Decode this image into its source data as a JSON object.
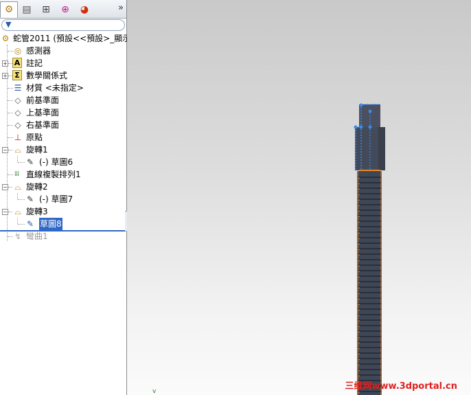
{
  "tabs": {
    "items": [
      {
        "name": "featuremanager-tab",
        "glyph": "🔧"
      },
      {
        "name": "propertymanager-tab",
        "glyph": "📋"
      },
      {
        "name": "configurationmanager-tab",
        "glyph": "🗂"
      },
      {
        "name": "dimxpert-tab",
        "glyph": "⊕"
      },
      {
        "name": "display-manager-tab",
        "glyph": "◑"
      }
    ],
    "more": "»"
  },
  "tree": {
    "root": "蛇管2011 (預設<<預設>_顯示",
    "items": [
      {
        "label": "感測器"
      },
      {
        "label": "註記"
      },
      {
        "label": "數學關係式"
      },
      {
        "label": "材質 <未指定>"
      },
      {
        "label": "前基準面"
      },
      {
        "label": "上基準面"
      },
      {
        "label": "右基準面"
      },
      {
        "label": "原點"
      },
      {
        "label": "旋轉1"
      },
      {
        "label": "(-) 草圖6"
      },
      {
        "label": "直線複製排列1"
      },
      {
        "label": "旋轉2"
      },
      {
        "label": "(-) 草圖7"
      },
      {
        "label": "旋轉3"
      },
      {
        "label": "草圖8"
      },
      {
        "label": "彎曲1"
      }
    ]
  },
  "viewport": {
    "watermark": "三维网www.3dportal.cn",
    "triad": "v"
  }
}
